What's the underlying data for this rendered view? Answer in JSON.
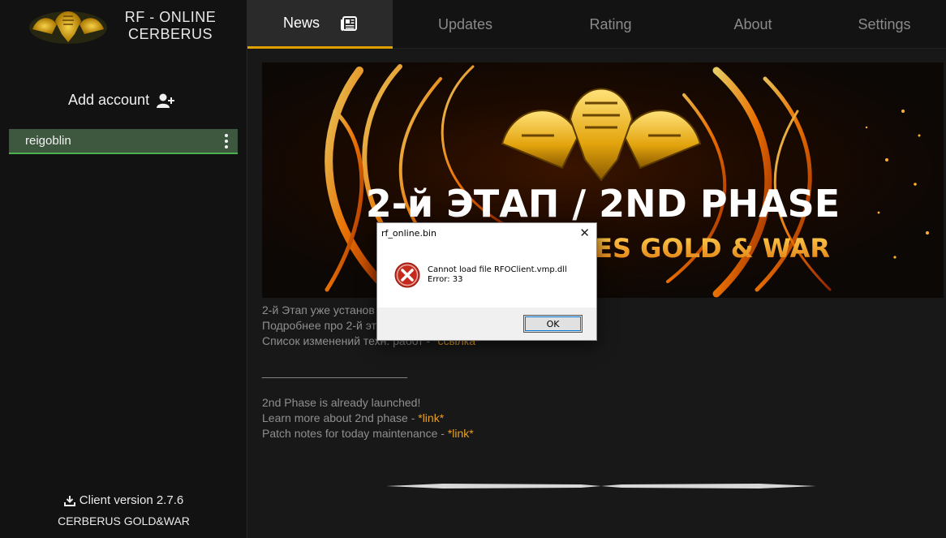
{
  "sidebar": {
    "brand_line1": "RF - ONLINE",
    "brand_line2": "CERBERUS",
    "add_account_label": "Add account",
    "accounts": [
      {
        "name": "reigoblin"
      }
    ],
    "client_version": "Client version 2.7.6",
    "footer": "CERBERUS GOLD&WAR"
  },
  "nav": {
    "tabs": [
      {
        "label": "News",
        "active": true
      },
      {
        "label": "Updates"
      },
      {
        "label": "Rating"
      },
      {
        "label": "About"
      },
      {
        "label": "Settings"
      }
    ]
  },
  "banner": {
    "headline": "2-й ЭТАП / 2ND PHASE",
    "subline": "MES GOLD & WAR"
  },
  "news": {
    "ru_line1": "2-й Этап уже установ",
    "ru_line2": "Подробнее про 2-й эт",
    "ru_line3_text": "Список изменений техн. работ - ",
    "ru_line3_link": "*ссылка*",
    "divider": "_______________________",
    "en_line1": "2nd Phase is already launched!",
    "en_line2_text": "Learn more about 2nd phase - ",
    "en_line2_link": "*link*",
    "en_line3_text": "Patch notes for today maintenance - ",
    "en_line3_link": "*link*"
  },
  "dialog": {
    "title": "rf_online.bin",
    "message": "Cannot load file RFOClient.vmp.dll",
    "error": "Error: 33",
    "ok_label": "OK"
  },
  "colors": {
    "accent": "#e0a100",
    "account_bg": "#3e5840",
    "account_border": "#4caf50",
    "link": "#e8a020"
  }
}
